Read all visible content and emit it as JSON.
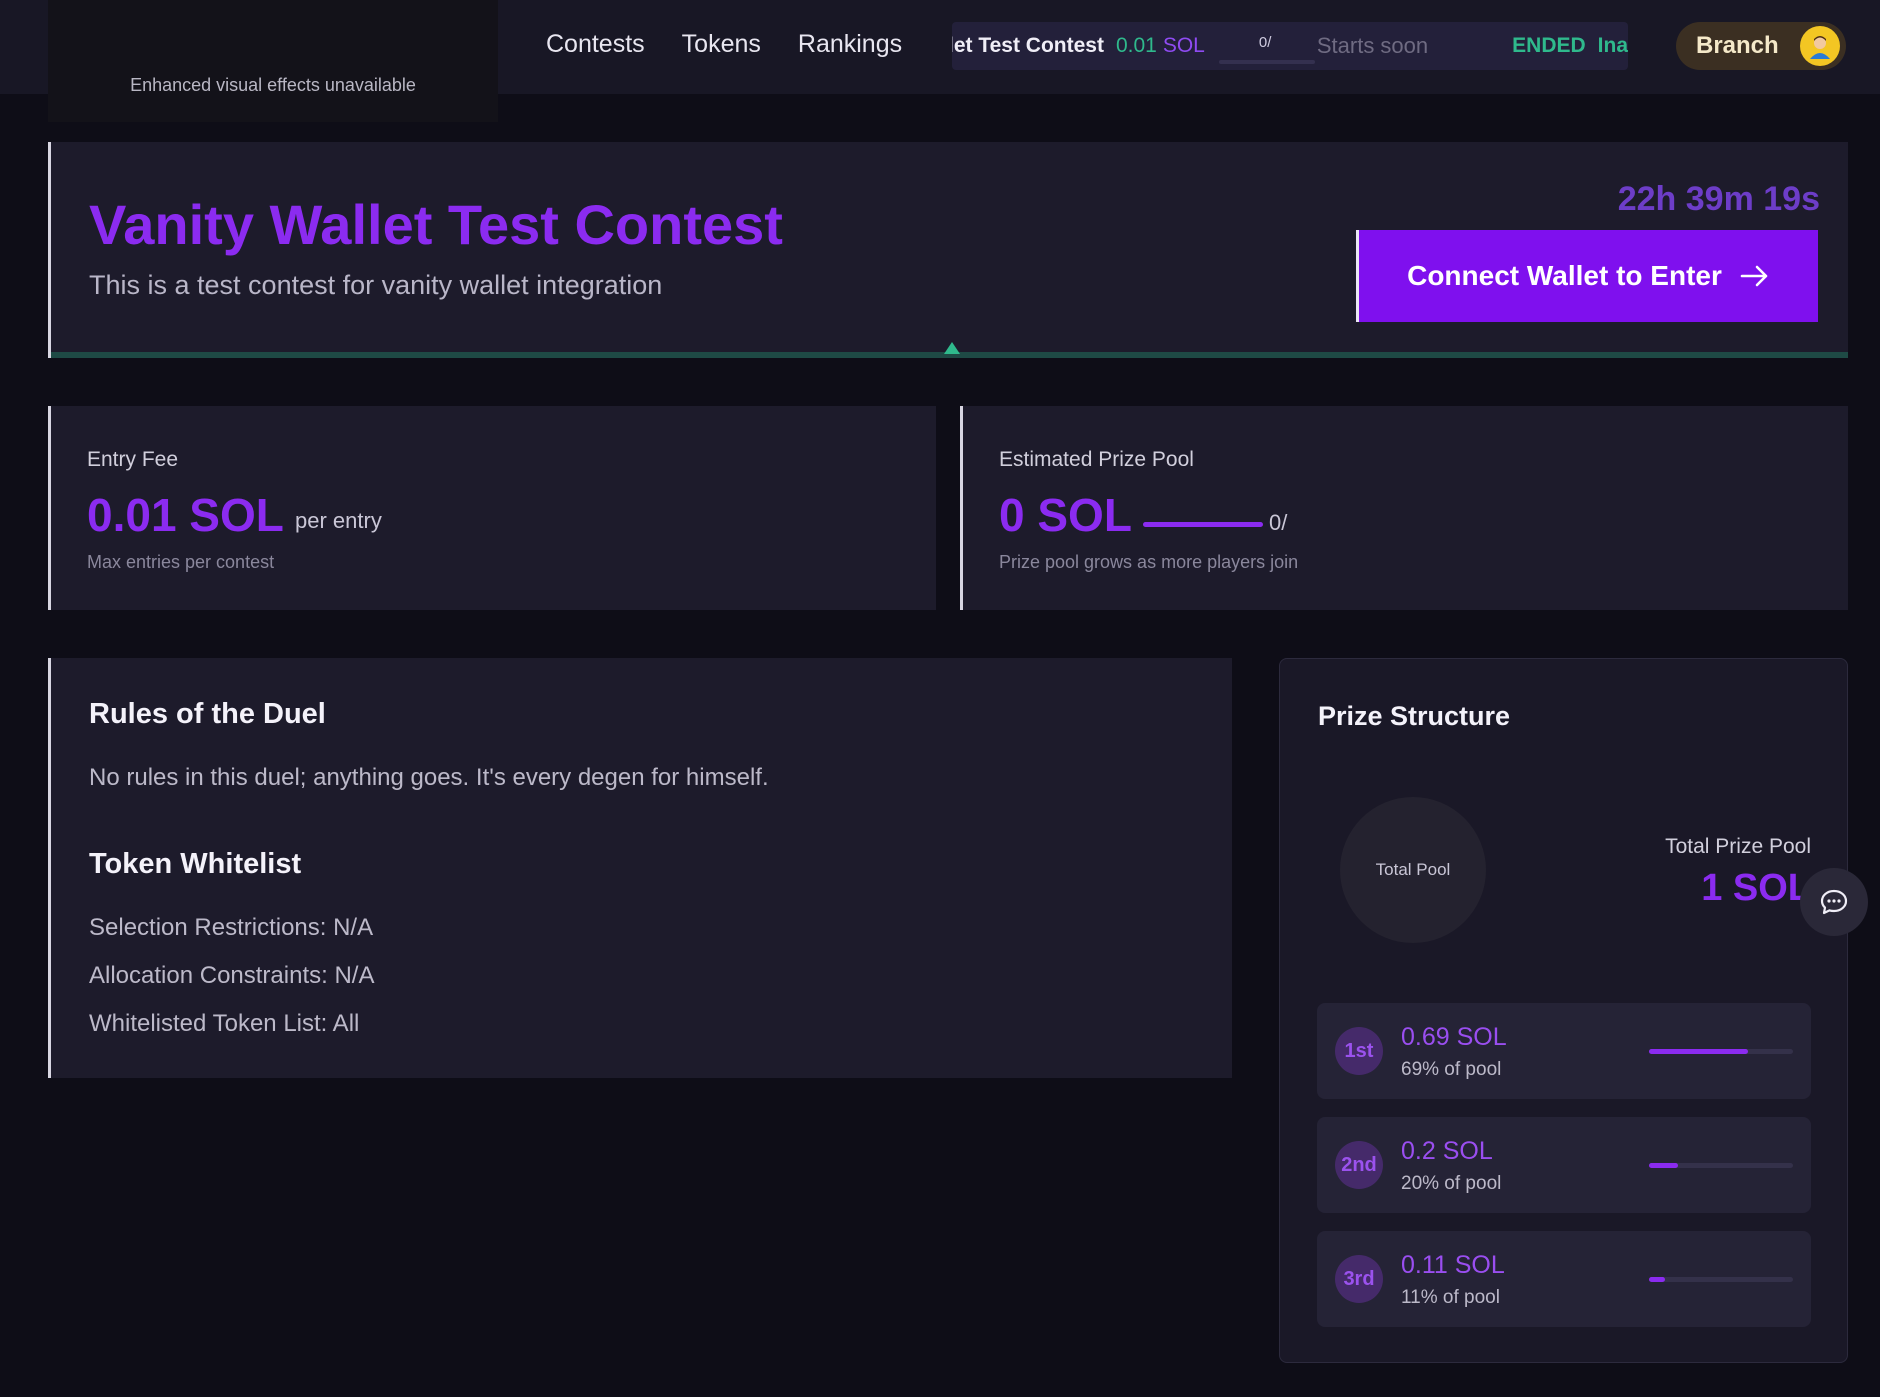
{
  "header": {
    "logo_notice": "Enhanced visual effects unavailable",
    "nav": [
      "Contests",
      "Tokens",
      "Rankings"
    ],
    "ticker": {
      "name": "let Test Contest",
      "fee": "0.01",
      "fee_unit": "SOL",
      "progress_label": "0/",
      "status": "Starts soon",
      "ended_label": "ENDED",
      "next_label": "Ina"
    },
    "user": {
      "name": "Branch"
    }
  },
  "hero": {
    "title": "Vanity Wallet Test Contest",
    "description": "This is a test contest for vanity wallet integration",
    "timer": "22h 39m 19s",
    "connect_label": "Connect Wallet to Enter"
  },
  "entry_fee": {
    "label": "Entry Fee",
    "value": "0.01 SOL",
    "per": "per entry",
    "sub": "Max entries per contest"
  },
  "prize_pool": {
    "label": "Estimated Prize Pool",
    "value": "0 SOL",
    "count": "0/",
    "sub": "Prize pool grows as more players join"
  },
  "rules": {
    "title": "Rules of the Duel",
    "text": "No rules in this duel; anything goes. It's every degen for himself.",
    "whitelist_title": "Token Whitelist",
    "selection": "Selection Restrictions: N/A",
    "allocation": "Allocation Constraints: N/A",
    "token_list": "Whitelisted Token List: All"
  },
  "prize_structure": {
    "title": "Prize Structure",
    "circle_label": "Total Pool",
    "total_label": "Total Prize Pool",
    "total_value": "1 SOL",
    "places": [
      {
        "rank": "1st",
        "amount": "0.69 SOL",
        "pct": "69% of pool",
        "fraction": 0.69
      },
      {
        "rank": "2nd",
        "amount": "0.2 SOL",
        "pct": "20% of pool",
        "fraction": 0.2
      },
      {
        "rank": "3rd",
        "amount": "0.11 SOL",
        "pct": "11% of pool",
        "fraction": 0.11
      }
    ]
  },
  "colors": {
    "accent": "#8b2bf0",
    "button": "#7f10ee",
    "success": "#2fb98c",
    "background": "#0e0d17",
    "panel": "#1d1b2b"
  }
}
